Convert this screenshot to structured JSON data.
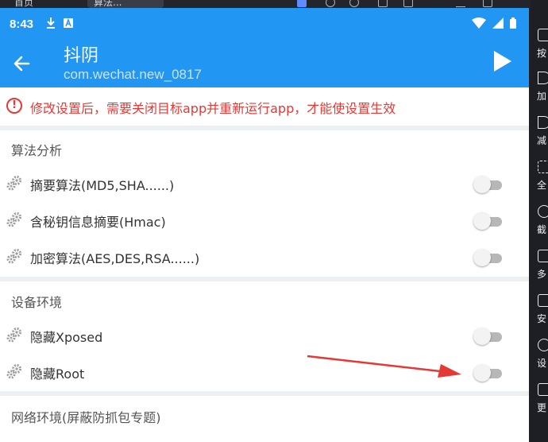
{
  "emulator": {
    "tabs": [
      {
        "label": "首页"
      },
      {
        "label": "算法..."
      }
    ]
  },
  "status_bar": {
    "time": "8:43"
  },
  "app_bar": {
    "title": "抖阴",
    "subtitle": "com.wechat.new_0817"
  },
  "warning": {
    "text": "修改设置后，需要关闭目标app并重新运行app，才能使设置生效"
  },
  "sections": [
    {
      "header": "算法分析",
      "items": [
        {
          "label": "摘要算法(MD5,SHA......)",
          "enabled": false
        },
        {
          "label": "含秘钥信息摘要(Hmac)",
          "enabled": false
        },
        {
          "label": "加密算法(AES,DES,RSA......)",
          "enabled": false
        }
      ]
    },
    {
      "header": "设备环境",
      "items": [
        {
          "label": "隐藏Xposed",
          "enabled": false
        },
        {
          "label": "隐藏Root",
          "enabled": false
        }
      ]
    },
    {
      "header": "网络环境(屏蔽防抓包专题)",
      "items": []
    }
  ],
  "toolbar": {
    "items": [
      {
        "label": "按",
        "icon": "keyboard-icon"
      },
      {
        "label": "加",
        "icon": "volume-up-icon"
      },
      {
        "label": "减",
        "icon": "volume-down-icon"
      },
      {
        "label": "全",
        "icon": "fullscreen-icon"
      },
      {
        "label": "截",
        "icon": "scissors-icon"
      },
      {
        "label": "多",
        "icon": "multi-window-icon"
      },
      {
        "label": "安",
        "icon": "apk-icon"
      },
      {
        "label": "设",
        "icon": "settings-icon"
      },
      {
        "label": "更",
        "icon": "more-icon"
      }
    ]
  },
  "colors": {
    "primary": "#2196f3",
    "warning": "#e53935",
    "arrow": "#e53935"
  }
}
